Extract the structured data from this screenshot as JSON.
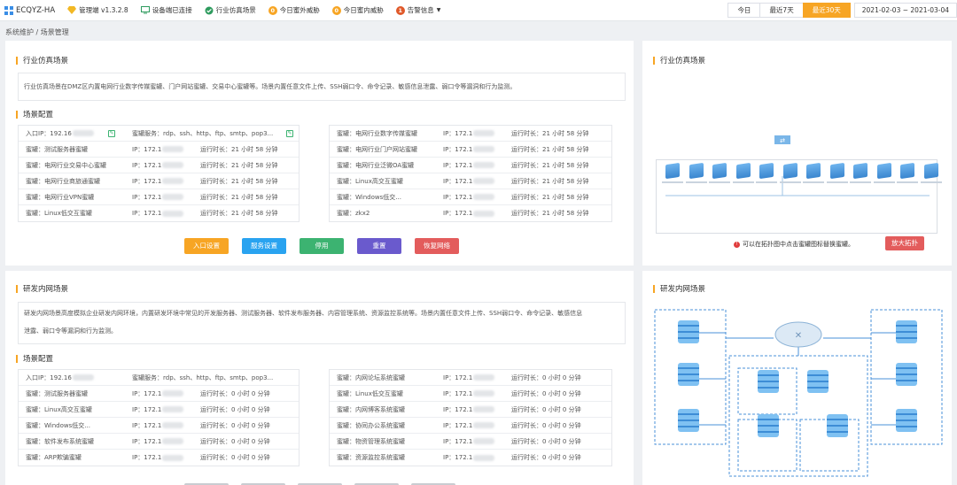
{
  "topbar": {
    "brand": "ECQYZ-HA",
    "manager": "管理端 v1.3.2.8",
    "device": "设备端已连接",
    "industry": "行业仿真场景",
    "ext_threat_count": "0",
    "ext_threat": "今日蜜外威胁",
    "int_threat_count": "0",
    "int_threat": "今日蜜内威胁",
    "alert_count": "1",
    "alert": "告警信息"
  },
  "range": {
    "today": "今日",
    "last7": "最近7天",
    "last30": "最近30天",
    "dates": "2021-02-03 ~ 2021-03-04"
  },
  "breadcrumb": "系统维护 / 场景管理",
  "industry": {
    "title": "行业仿真场景",
    "desc": "行业仿真场景在DMZ区内置电网行业数字传媒蜜罐、门户网站蜜罐、交易中心蜜罐等。场景内置任意文件上传、SSH弱口令、命令记录、敏感信息泄露、弱口令等漏洞和行为监测。",
    "config_title": "场景配置",
    "entry_ip": "入口IP：192.16",
    "service": "蜜罐服务：rdp、ssh、http、ftp、smtp、pop3...",
    "left_rows": [
      {
        "name": "蜜罐：测试服务器蜜罐",
        "ip": "IP：172.1",
        "time": "运行时长：21 小时 58 分钟"
      },
      {
        "name": "蜜罐：电网行业交易中心蜜罐",
        "ip": "IP：172.1",
        "time": "运行时长：21 小时 58 分钟"
      },
      {
        "name": "蜜罐：电网行业商旅通蜜罐",
        "ip": "IP：172.1",
        "time": "运行时长：21 小时 58 分钟"
      },
      {
        "name": "蜜罐：电网行业VPN蜜罐",
        "ip": "IP：172.1",
        "time": "运行时长：21 小时 58 分钟"
      },
      {
        "name": "蜜罐：Linux低交互蜜罐",
        "ip": "IP：172.1",
        "time": "运行时长：21 小时 58 分钟"
      }
    ],
    "right_rows": [
      {
        "name": "蜜罐：电网行业数字传媒蜜罐",
        "ip": "IP：172.1",
        "time": "运行时长：21 小时 58 分钟"
      },
      {
        "name": "蜜罐：电网行业门户网站蜜罐",
        "ip": "IP：172.1",
        "time": "运行时长：21 小时 58 分钟"
      },
      {
        "name": "蜜罐：电网行业泛微OA蜜罐",
        "ip": "IP：172.1",
        "time": "运行时长：21 小时 58 分钟"
      },
      {
        "name": "蜜罐：Linux高交互蜜罐",
        "ip": "IP：172.1",
        "time": "运行时长：21 小时 58 分钟"
      },
      {
        "name": "蜜罐：Windows低交...",
        "ip": "IP：172.1",
        "time": "运行时长：21 小时 58 分钟"
      },
      {
        "name": "蜜罐：zkx2",
        "ip": "IP：172.1",
        "time": "运行时长：21 小时 58 分钟"
      }
    ],
    "buttons": [
      "入口设置",
      "服务设置",
      "停用",
      "重置",
      "恢复网络"
    ],
    "topo_title": "行业仿真场景",
    "hint": "可以在拓扑图中点击蜜罐图标替换蜜罐。",
    "expand": "放大拓扑"
  },
  "rd": {
    "title": "研发内网场景",
    "desc1": "研发内网场景高度模拟企业研发内网环境，内置研发环境中常见的开发服务器、测试服务器、软件发布服务器、内容管理系统、资源监控系统等。场景内置任意文件上传、SSH弱口令、命令记录、敏感信息",
    "desc2": "泄露、弱口令等漏洞和行为监测。",
    "config_title": "场景配置",
    "entry_ip": "入口IP：192.16",
    "service": "蜜罐服务：rdp、ssh、http、ftp、smtp、pop3...",
    "left_rows": [
      {
        "name": "蜜罐：测试服务器蜜罐",
        "ip": "IP：172.1",
        "time": "运行时长：0 小时 0 分钟"
      },
      {
        "name": "蜜罐：Linux高交互蜜罐",
        "ip": "IP：172.1",
        "time": "运行时长：0 小时 0 分钟"
      },
      {
        "name": "蜜罐：Windows低交...",
        "ip": "IP：172.1",
        "time": "运行时长：0 小时 0 分钟"
      },
      {
        "name": "蜜罐：软件发布系统蜜罐",
        "ip": "IP：172.1",
        "time": "运行时长：0 小时 0 分钟"
      },
      {
        "name": "蜜罐：ARP欺骗蜜罐",
        "ip": "IP：172.1",
        "time": "运行时长：0 小时 0 分钟"
      }
    ],
    "right_rows": [
      {
        "name": "蜜罐：内网论坛系统蜜罐",
        "ip": "IP：172.1",
        "time": "运行时长：0 小时 0 分钟"
      },
      {
        "name": "蜜罐：Linux低交互蜜罐",
        "ip": "IP：172.1",
        "time": "运行时长：0 小时 0 分钟"
      },
      {
        "name": "蜜罐：内网博客系统蜜罐",
        "ip": "IP：172.1",
        "time": "运行时长：0 小时 0 分钟"
      },
      {
        "name": "蜜罐：协同办公系统蜜罐",
        "ip": "IP：172.1",
        "time": "运行时长：0 小时 0 分钟"
      },
      {
        "name": "蜜罐：物资管理系统蜜罐",
        "ip": "IP：172.1",
        "time": "运行时长：0 小时 0 分钟"
      },
      {
        "name": "蜜罐：资源监控系统蜜罐",
        "ip": "IP：172.1",
        "time": "运行时长：0 小时 0 分钟"
      }
    ],
    "topo_title": "研发内网场景"
  },
  "colors": {
    "accent": "#f7a524",
    "blue": "#29a3f0",
    "green": "#3cb371",
    "purple": "#6a5acd",
    "red": "#e35c5c"
  }
}
